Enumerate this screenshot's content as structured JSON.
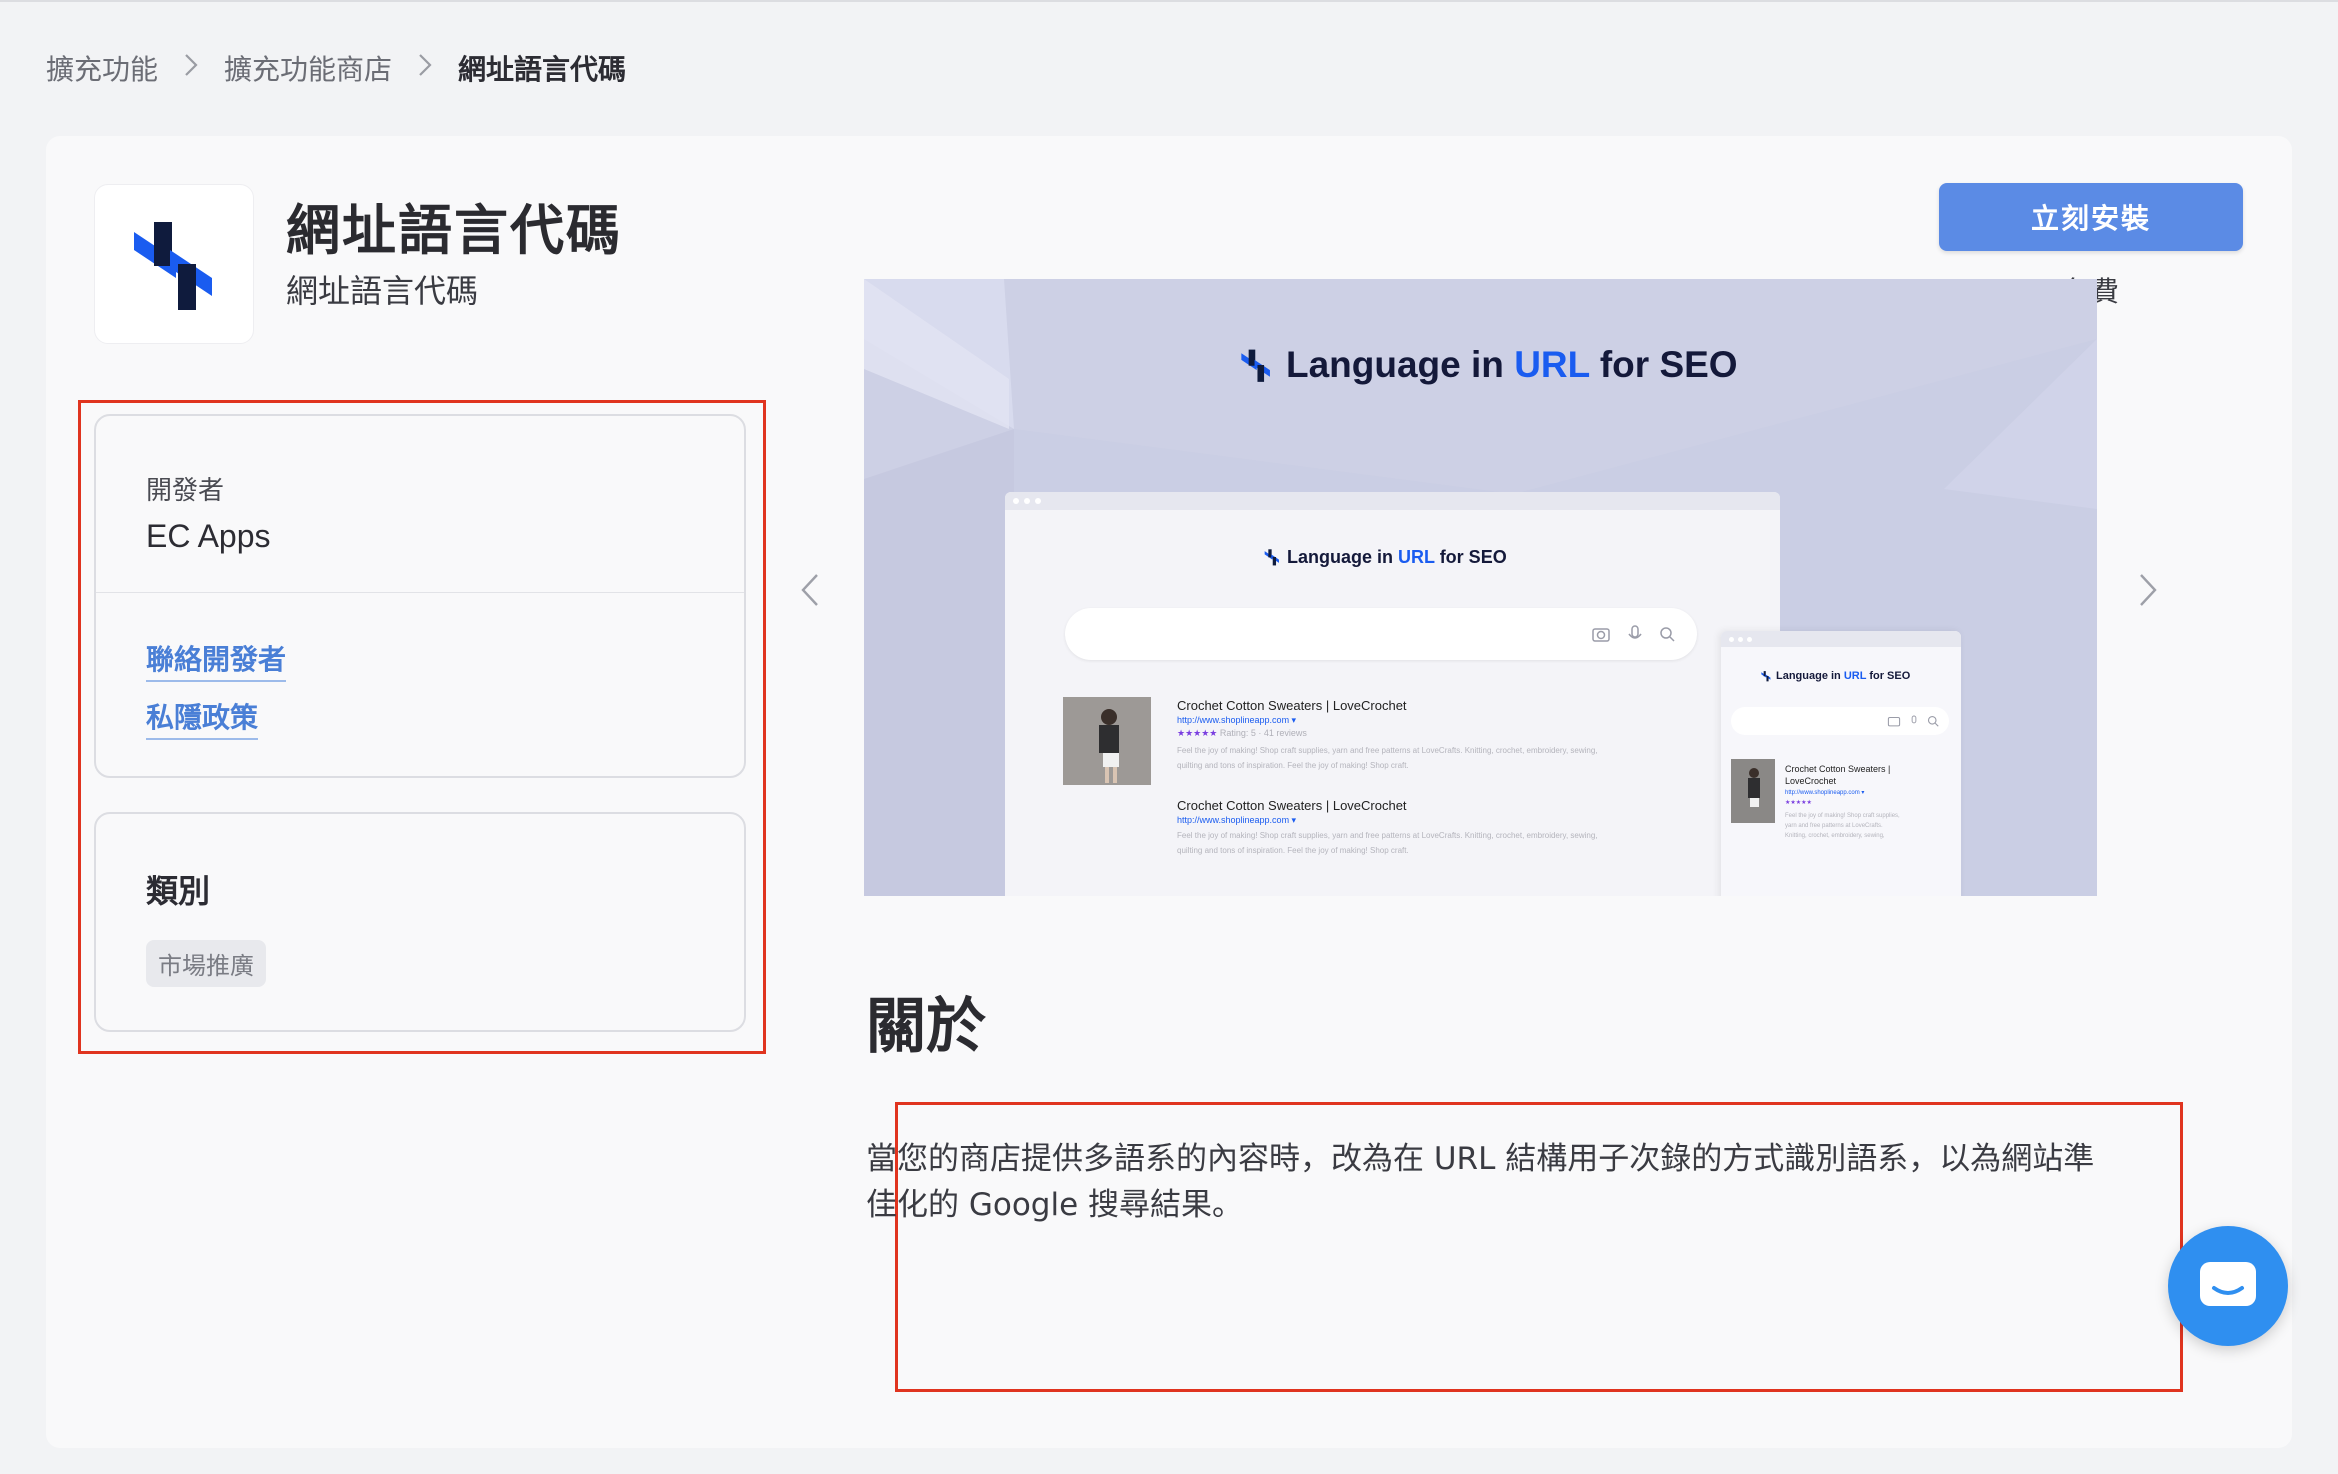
{
  "breadcrumb": {
    "items": [
      "擴充功能",
      "擴充功能商店"
    ],
    "current": "網址語言代碼"
  },
  "app": {
    "title": "網址語言代碼",
    "subtitle": "網址語言代碼",
    "install_label": "立刻安裝",
    "price": "免費"
  },
  "developer": {
    "label": "開發者",
    "name": "EC Apps",
    "contact_link": "聯絡開發者",
    "privacy_link": "私隱政策"
  },
  "category": {
    "title": "類別",
    "tag": "市場推廣"
  },
  "screenshot": {
    "headline_prefix": "Language in ",
    "headline_highlight": "URL",
    "headline_suffix": " for SEO",
    "result_title": "Crochet Cotton Sweaters | LoveCrochet",
    "result_url": "http://www.shoplineapp.com ▾",
    "result_rating": "Rating: 5 · 41 reviews",
    "result_snippet_1": "Feel the joy of making! Shop craft supplies, yarn and free patterns at LoveCrafts. Knitting, crochet, embroidery, sewing,",
    "result_snippet_2": "quilting and tons of inspiration. Feel the joy of making! Shop craft.",
    "mobile_title_1": "Crochet Cotton Sweaters |",
    "mobile_title_2": "LoveCrochet"
  },
  "about": {
    "title": "關於",
    "line1": "當您的商店提供多語系的內容時，改為在 URL 結構用子次錄的方式識別語系，以為網站準",
    "line2": "佳化的 Google 搜尋結果。"
  },
  "colors": {
    "install_button": "#5b8be5",
    "link": "#4a7fd6",
    "annotation_red": "#e0341f",
    "chat_bubble": "#2f8ff0",
    "logo_dark": "#0f1b3d",
    "logo_blue": "#1a5cf0"
  },
  "icons": {
    "carousel_prev": "chevron-left-icon",
    "carousel_next": "chevron-right-icon",
    "chat": "chat-icon"
  }
}
